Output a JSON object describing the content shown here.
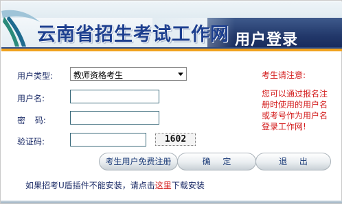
{
  "header": {
    "site_title": "云南省招生考试工作网",
    "login_title": "用户登录"
  },
  "form": {
    "user_type_label": "用户类型:",
    "user_type_selected": "教师资格考生",
    "username_label": "用户名:",
    "username_value": "",
    "password_label": "密 码:",
    "password_value": "",
    "captcha_label": "验证码:",
    "captcha_value": "",
    "captcha_image_text": "1602"
  },
  "notice": {
    "title": "考生请注意:",
    "body": "您可以通过报名注册时使用的用户名或考号作为用户名登录工作网!"
  },
  "buttons": {
    "register": "考生用户免费注册",
    "confirm": "确 定",
    "exit": "退 出"
  },
  "footer": {
    "text_before": "如果招考U盾插件不能安装，请点击",
    "link_text": "这里",
    "text_after": "下载安装"
  },
  "colors": {
    "title_blue": "#1d3f8f",
    "header_dark": "#22386a",
    "accent_orange": "#f0a21e",
    "notice_red": "#d31b1b"
  }
}
